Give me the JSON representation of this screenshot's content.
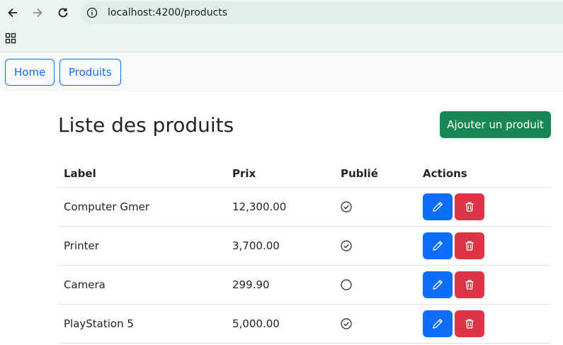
{
  "browser": {
    "url": "localhost:4200/products"
  },
  "navbar": {
    "home_label": "Home",
    "produits_label": "Produits"
  },
  "page": {
    "title": "Liste des produits",
    "add_button_label": "Ajouter un produit"
  },
  "table": {
    "headers": [
      "Label",
      "Prix",
      "Publié",
      "Actions"
    ],
    "rows": [
      {
        "label": "Computer Gmer",
        "prix": "12,300.00",
        "publie": true
      },
      {
        "label": "Printer",
        "prix": "3,700.00",
        "publie": true
      },
      {
        "label": "Camera",
        "prix": "299.90",
        "publie": false
      },
      {
        "label": "PlayStation 5",
        "prix": "5,000.00",
        "publie": true
      }
    ]
  },
  "icons": {
    "published": "check-circle-icon",
    "unpublished": "circle-icon",
    "edit": "pencil-icon",
    "delete": "trash-icon"
  },
  "colors": {
    "primary": "#0d6efd",
    "success": "#198754",
    "danger": "#dc3545"
  }
}
